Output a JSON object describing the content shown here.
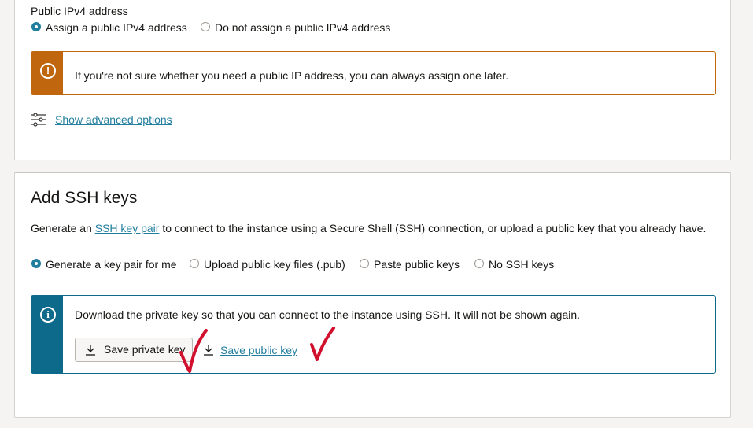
{
  "network": {
    "ipv4_label": "Public IPv4 address",
    "options": [
      {
        "label": "Assign a public IPv4 address",
        "selected": true
      },
      {
        "label": "Do not assign a public IPv4 address",
        "selected": false
      }
    ],
    "warning_text": "If you're not sure whether you need a public IP address, you can always assign one later.",
    "advanced_link": "Show advanced options"
  },
  "ssh": {
    "title": "Add SSH keys",
    "desc_prefix": "Generate an ",
    "desc_link": "SSH key pair",
    "desc_suffix": " to connect to the instance using a Secure Shell (SSH) connection, or upload a public key that you already have.",
    "options": [
      {
        "label": "Generate a key pair for me",
        "selected": true
      },
      {
        "label": "Upload public key files (.pub)",
        "selected": false
      },
      {
        "label": "Paste public keys",
        "selected": false
      },
      {
        "label": "No SSH keys",
        "selected": false
      }
    ],
    "info_text": "Download the private key so that you can connect to the instance using SSH. It will not be shown again.",
    "save_private_label": "Save private key",
    "save_public_label": "Save public key"
  },
  "colors": {
    "accent": "#227e9e",
    "warning": "#c0660f",
    "info": "#0d6a8a",
    "annotation": "#d1102e"
  },
  "icons": [
    "warning-icon",
    "info-icon",
    "sliders-icon",
    "download-icon",
    "checkmark-annotation"
  ]
}
